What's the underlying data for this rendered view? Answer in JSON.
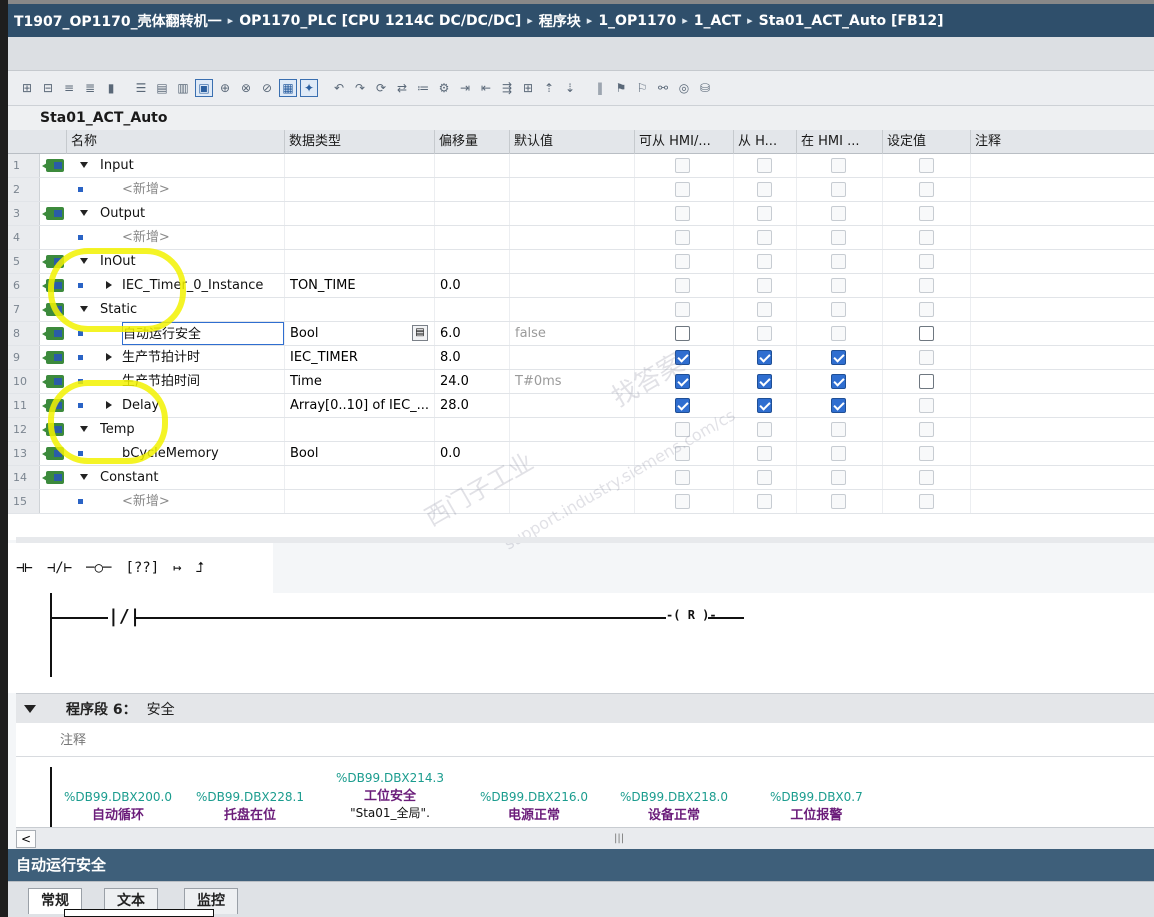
{
  "breadcrumb": {
    "items": [
      "T1907_OP1170_壳体翻转机一",
      "OP1170_PLC [CPU 1214C DC/DC/DC]",
      "程序块",
      "1_OP1170",
      "1_ACT",
      "Sta01_ACT_Auto [FB12]"
    ],
    "separator": "▸"
  },
  "block": {
    "name": "Sta01_ACT_Auto"
  },
  "table": {
    "headers": [
      "名称",
      "数据类型",
      "偏移量",
      "默认值",
      "可从 HMI/...",
      "从 H...",
      "在 HMI ...",
      "设定值",
      "注释"
    ],
    "rows": [
      {
        "num": "1",
        "name": "Input",
        "kind": "section",
        "type": "",
        "offset": "",
        "default": "",
        "hmi1": "off",
        "hmi2": "off",
        "hmi3": "off",
        "set": "off",
        "icon": true
      },
      {
        "num": "2",
        "name": "<新增>",
        "kind": "add",
        "type": "",
        "offset": "",
        "default": "",
        "hmi1": "off",
        "hmi2": "off",
        "hmi3": "off",
        "set": "off",
        "icon": false
      },
      {
        "num": "3",
        "name": "Output",
        "kind": "section",
        "type": "",
        "offset": "",
        "default": "",
        "hmi1": "off",
        "hmi2": "off",
        "hmi3": "off",
        "set": "off",
        "icon": true
      },
      {
        "num": "4",
        "name": "<新增>",
        "kind": "add",
        "type": "",
        "offset": "",
        "default": "",
        "hmi1": "off",
        "hmi2": "off",
        "hmi3": "off",
        "set": "off",
        "icon": false
      },
      {
        "num": "5",
        "name": "InOut",
        "kind": "section",
        "type": "",
        "offset": "",
        "default": "",
        "hmi1": "off",
        "hmi2": "off",
        "hmi3": "off",
        "set": "off",
        "icon": true
      },
      {
        "num": "6",
        "name": "IEC_Timer_0_Instance",
        "kind": "struct",
        "type": "TON_TIME",
        "offset": "0.0",
        "default": "",
        "hmi1": "off",
        "hmi2": "off",
        "hmi3": "off",
        "set": "off",
        "icon": true
      },
      {
        "num": "7",
        "name": "Static",
        "kind": "section",
        "type": "",
        "offset": "",
        "default": "",
        "hmi1": "off",
        "hmi2": "off",
        "hmi3": "off",
        "set": "off",
        "icon": true
      },
      {
        "num": "8",
        "name": "自动运行安全",
        "kind": "item",
        "type": "Bool",
        "offset": "6.0",
        "default": "false",
        "hmi1": "dark",
        "hmi2": "off",
        "hmi3": "off",
        "set": "dark",
        "icon": true
      },
      {
        "num": "9",
        "name": "生产节拍计时",
        "kind": "struct",
        "type": "IEC_TIMER",
        "offset": "8.0",
        "default": "",
        "hmi1": "on",
        "hmi2": "on",
        "hmi3": "on",
        "set": "off",
        "icon": true
      },
      {
        "num": "10",
        "name": "生产节拍时间",
        "kind": "item",
        "type": "Time",
        "offset": "24.0",
        "default": "T#0ms",
        "hmi1": "on",
        "hmi2": "on",
        "hmi3": "on",
        "set": "dark",
        "icon": true
      },
      {
        "num": "11",
        "name": "Delay",
        "kind": "struct",
        "type": "Array[0..10] of IEC_...",
        "offset": "28.0",
        "default": "",
        "hmi1": "on",
        "hmi2": "on",
        "hmi3": "on",
        "set": "off",
        "icon": true
      },
      {
        "num": "12",
        "name": "Temp",
        "kind": "section",
        "type": "",
        "offset": "",
        "default": "",
        "hmi1": "off",
        "hmi2": "off",
        "hmi3": "off",
        "set": "off",
        "icon": true
      },
      {
        "num": "13",
        "name": "bCycleMemory",
        "kind": "item",
        "type": "Bool",
        "offset": "0.0",
        "default": "",
        "hmi1": "off",
        "hmi2": "off",
        "hmi3": "off",
        "set": "off",
        "icon": true
      },
      {
        "num": "14",
        "name": "Constant",
        "kind": "section",
        "type": "",
        "offset": "",
        "default": "",
        "hmi1": "off",
        "hmi2": "off",
        "hmi3": "off",
        "set": "off",
        "icon": true
      },
      {
        "num": "15",
        "name": "<新增>",
        "kind": "add",
        "type": "",
        "offset": "",
        "default": "",
        "hmi1": "off",
        "hmi2": "off",
        "hmi3": "off",
        "set": "off",
        "icon": false
      }
    ]
  },
  "watermark": {
    "line1": "西门子工业",
    "line2": "support.industry.siemens.com/cs",
    "line3": "找答案"
  },
  "ladder_palette": [
    "⊣⊢",
    "⊣/⊢",
    "─○─",
    "[??]",
    "↦",
    "⮥"
  ],
  "ladder_rung": {
    "coil": "R"
  },
  "network": {
    "title": "程序段 6：",
    "name": "安全",
    "comment": "注释"
  },
  "contacts": [
    {
      "addr": "%DB99.DBX200.0",
      "label": "自动循环",
      "sym": ""
    },
    {
      "addr": "%DB99.DBX228.1",
      "label": "托盘在位",
      "sym": ""
    },
    {
      "addr": "%DB99.DBX214.3",
      "label": "工位安全",
      "sym": "\"Sta01_全局\"."
    },
    {
      "addr": "%DB99.DBX216.0",
      "label": "电源正常",
      "sym": ""
    },
    {
      "addr": "%DB99.DBX218.0",
      "label": "设备正常",
      "sym": ""
    },
    {
      "addr": "%DB99.DBX0.7",
      "label": "工位报警",
      "sym": ""
    }
  ],
  "properties": {
    "title": "自动运行安全",
    "tabs": [
      "常规",
      "文本",
      "监控"
    ]
  },
  "colors": {
    "title_bg": "#2f4f6b",
    "highlight": "#f2f200",
    "check_blue": "#2f6ed0",
    "address_teal": "#1a9c8e",
    "label_purple": "#6b1d7a"
  }
}
